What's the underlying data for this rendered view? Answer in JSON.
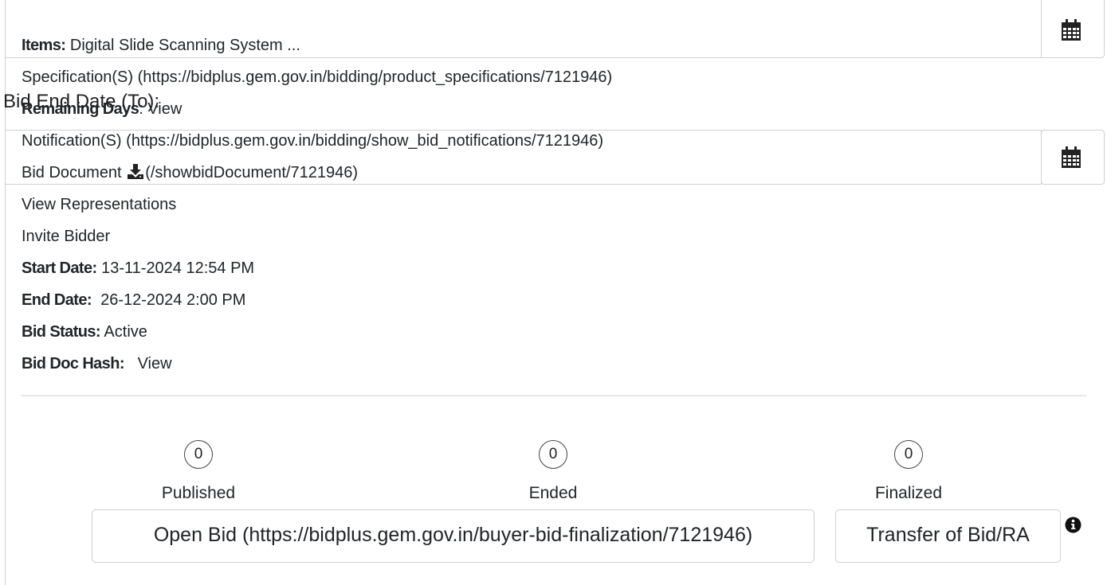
{
  "items": {
    "label": "Items:",
    "value": "Digital Slide Scanning System ..."
  },
  "specification": {
    "text": "Specification(S) (https://bidplus.gem.gov.in/bidding/product_specifications/7121946)"
  },
  "bid_end_date": {
    "label": "Bid End Date (To):"
  },
  "remaining_days": {
    "label": "Remaining Days",
    "value": ": View"
  },
  "notification": {
    "text": "Notification(S) (https://bidplus.gem.gov.in/bidding/show_bid_notifications/7121946)"
  },
  "bid_document": {
    "prefix": "Bid Document",
    "link": "(/showbidDocument/7121946)"
  },
  "view_representations": "View Representations",
  "invite_bidder": "Invite Bidder",
  "start_date": {
    "label": "Start Date:",
    "value": "13-11-2024 12:54 PM"
  },
  "end_date": {
    "label": "End Date:",
    "value": "26-12-2024 2:00 PM"
  },
  "bid_status": {
    "label": "Bid Status:",
    "value": "Active"
  },
  "bid_doc_hash": {
    "label": "Bid Doc Hash:",
    "value": "View"
  },
  "counters": [
    {
      "count": "0",
      "label": "Published"
    },
    {
      "count": "0",
      "label": "Ended"
    },
    {
      "count": "0",
      "label": "Finalized"
    }
  ],
  "buttons": {
    "open_bid": "Open Bid (https://bidplus.gem.gov.in/buyer-bid-finalization/7121946)",
    "transfer": "Transfer of Bid/RA"
  },
  "icons": {
    "calendar": "calendar-icon",
    "download": "download-icon",
    "info": "info-circle-icon"
  }
}
